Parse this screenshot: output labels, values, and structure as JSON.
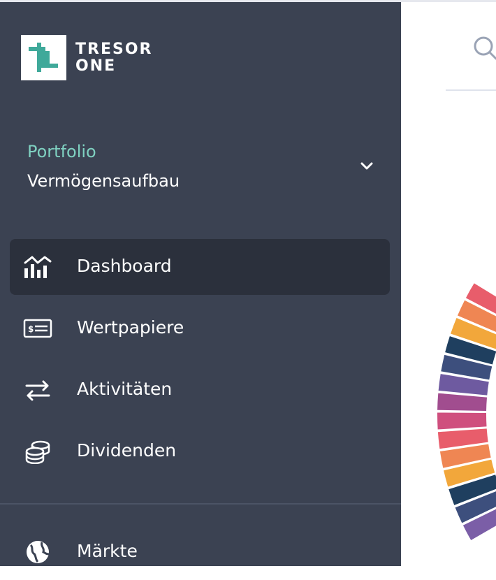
{
  "brand": {
    "line1": "TRESOR",
    "line2": "ONE",
    "accent": "#3fa99a"
  },
  "portfolio": {
    "label": "Portfolio",
    "name": "Vermögensaufbau"
  },
  "nav": {
    "items": [
      {
        "label": "Dashboard",
        "icon": "chart-icon",
        "active": true
      },
      {
        "label": "Wertpapiere",
        "icon": "securities-icon",
        "active": false
      },
      {
        "label": "Aktivitäten",
        "icon": "transfer-icon",
        "active": false
      },
      {
        "label": "Dividenden",
        "icon": "coins-icon",
        "active": false
      },
      {
        "label": "Märkte",
        "icon": "globe-icon",
        "active": false
      }
    ]
  },
  "colors": {
    "sidebar": "#3b4252",
    "active_item": "#2b303c",
    "portfolio_label": "#7fd1c1"
  }
}
